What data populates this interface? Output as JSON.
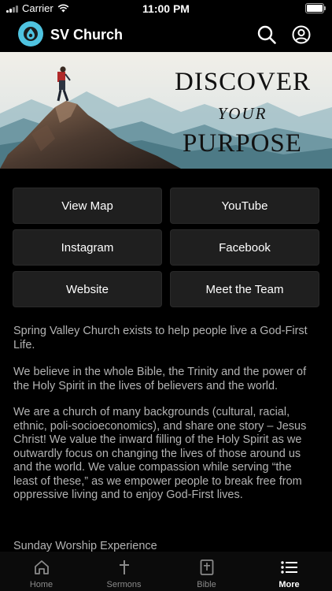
{
  "status_bar": {
    "carrier": "Carrier",
    "time": "11:00 PM"
  },
  "nav": {
    "title": "SV Church",
    "logo_color": "#4fc3e0"
  },
  "banner": {
    "line1": "DISCOVER",
    "line2": "YOUR",
    "line3": "PURPOSE"
  },
  "buttons": [
    {
      "label": "View Map"
    },
    {
      "label": "YouTube"
    },
    {
      "label": "Instagram"
    },
    {
      "label": "Facebook"
    },
    {
      "label": "Website"
    },
    {
      "label": "Meet the Team"
    }
  ],
  "content": {
    "p1": "Spring Valley Church exists to help people live a God-First Life.",
    "p2": "We believe in the whole Bible, the Trinity and the power of the Holy Spirit in the lives of believers and the world.",
    "p3": "We are a church of many backgrounds (cultural, racial, ethnic, poli-socioeconomics), and share one story – Jesus Christ! We value the inward filling of the Holy Spirit as we outwardly focus on changing the lives of those around us and the world. We value compassion while serving “the least of these,” as we empower people to break free from oppressive living and to enjoy God-First lives.",
    "section_heading": "Sunday Worship Experience"
  },
  "tabs": [
    {
      "label": "Home",
      "icon": "home-icon"
    },
    {
      "label": "Sermons",
      "icon": "cross-icon"
    },
    {
      "label": "Bible",
      "icon": "bible-icon"
    },
    {
      "label": "More",
      "icon": "list-icon",
      "active": true
    }
  ]
}
